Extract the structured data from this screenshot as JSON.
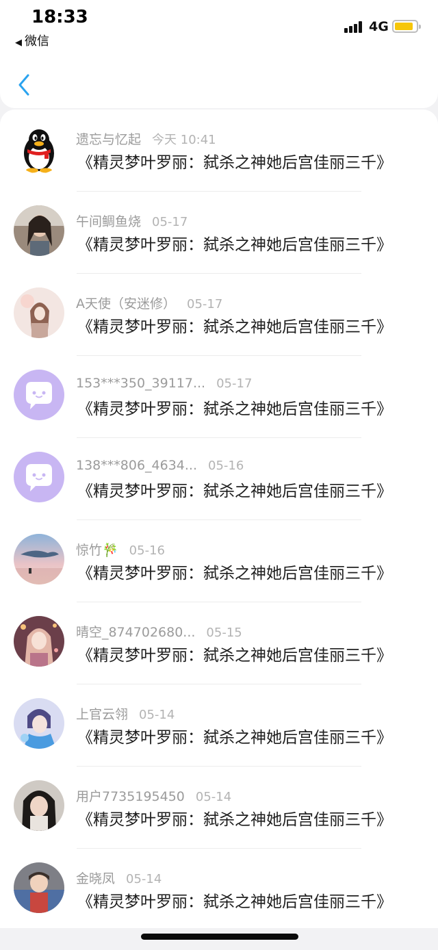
{
  "status_bar": {
    "time": "18:33",
    "back_app": "微信",
    "network": "4G",
    "battery_color": "#f6c60a"
  },
  "nav": {
    "back_icon": "chevron-left-icon",
    "accent": "#2aa3ef"
  },
  "items": [
    {
      "name": "遗忘与忆起",
      "date": "今天 10:41",
      "message": "《精灵梦叶罗丽：弑杀之神她后宫佳丽三千》",
      "avatar": "qq-penguin"
    },
    {
      "name": "午间鲷鱼烧",
      "date": "05-17",
      "message": "《精灵梦叶罗丽：弑杀之神她后宫佳丽三千》",
      "avatar": "photo"
    },
    {
      "name": "A天使（安迷修）",
      "date": "05-17",
      "message": "《精灵梦叶罗丽：弑杀之神她后宫佳丽三千》",
      "avatar": "anime"
    },
    {
      "name": "153***350_39117...",
      "date": "05-17",
      "message": "《精灵梦叶罗丽：弑杀之神她后宫佳丽三千》",
      "avatar": "default-chat"
    },
    {
      "name": "138***806_4634...",
      "date": "05-16",
      "message": "《精灵梦叶罗丽：弑杀之神她后宫佳丽三千》",
      "avatar": "default-chat"
    },
    {
      "name": "惊竹🎋",
      "date": "05-16",
      "message": "《精灵梦叶罗丽：弑杀之神她后宫佳丽三千》",
      "avatar": "whale-scene"
    },
    {
      "name": "晴空_874702680...",
      "date": "05-15",
      "message": "《精灵梦叶罗丽：弑杀之神她后宫佳丽三千》",
      "avatar": "anime-girl"
    },
    {
      "name": "上官云翎",
      "date": "05-14",
      "message": "《精灵梦叶罗丽：弑杀之神她后宫佳丽三千》",
      "avatar": "anime-boy"
    },
    {
      "name": "用户7735195450",
      "date": "05-14",
      "message": "《精灵梦叶罗丽：弑杀之神她后宫佳丽三千》",
      "avatar": "photo"
    },
    {
      "name": "金晓凤",
      "date": "05-14",
      "message": "《精灵梦叶罗丽：弑杀之神她后宫佳丽三千》",
      "avatar": "baby-photo"
    }
  ]
}
